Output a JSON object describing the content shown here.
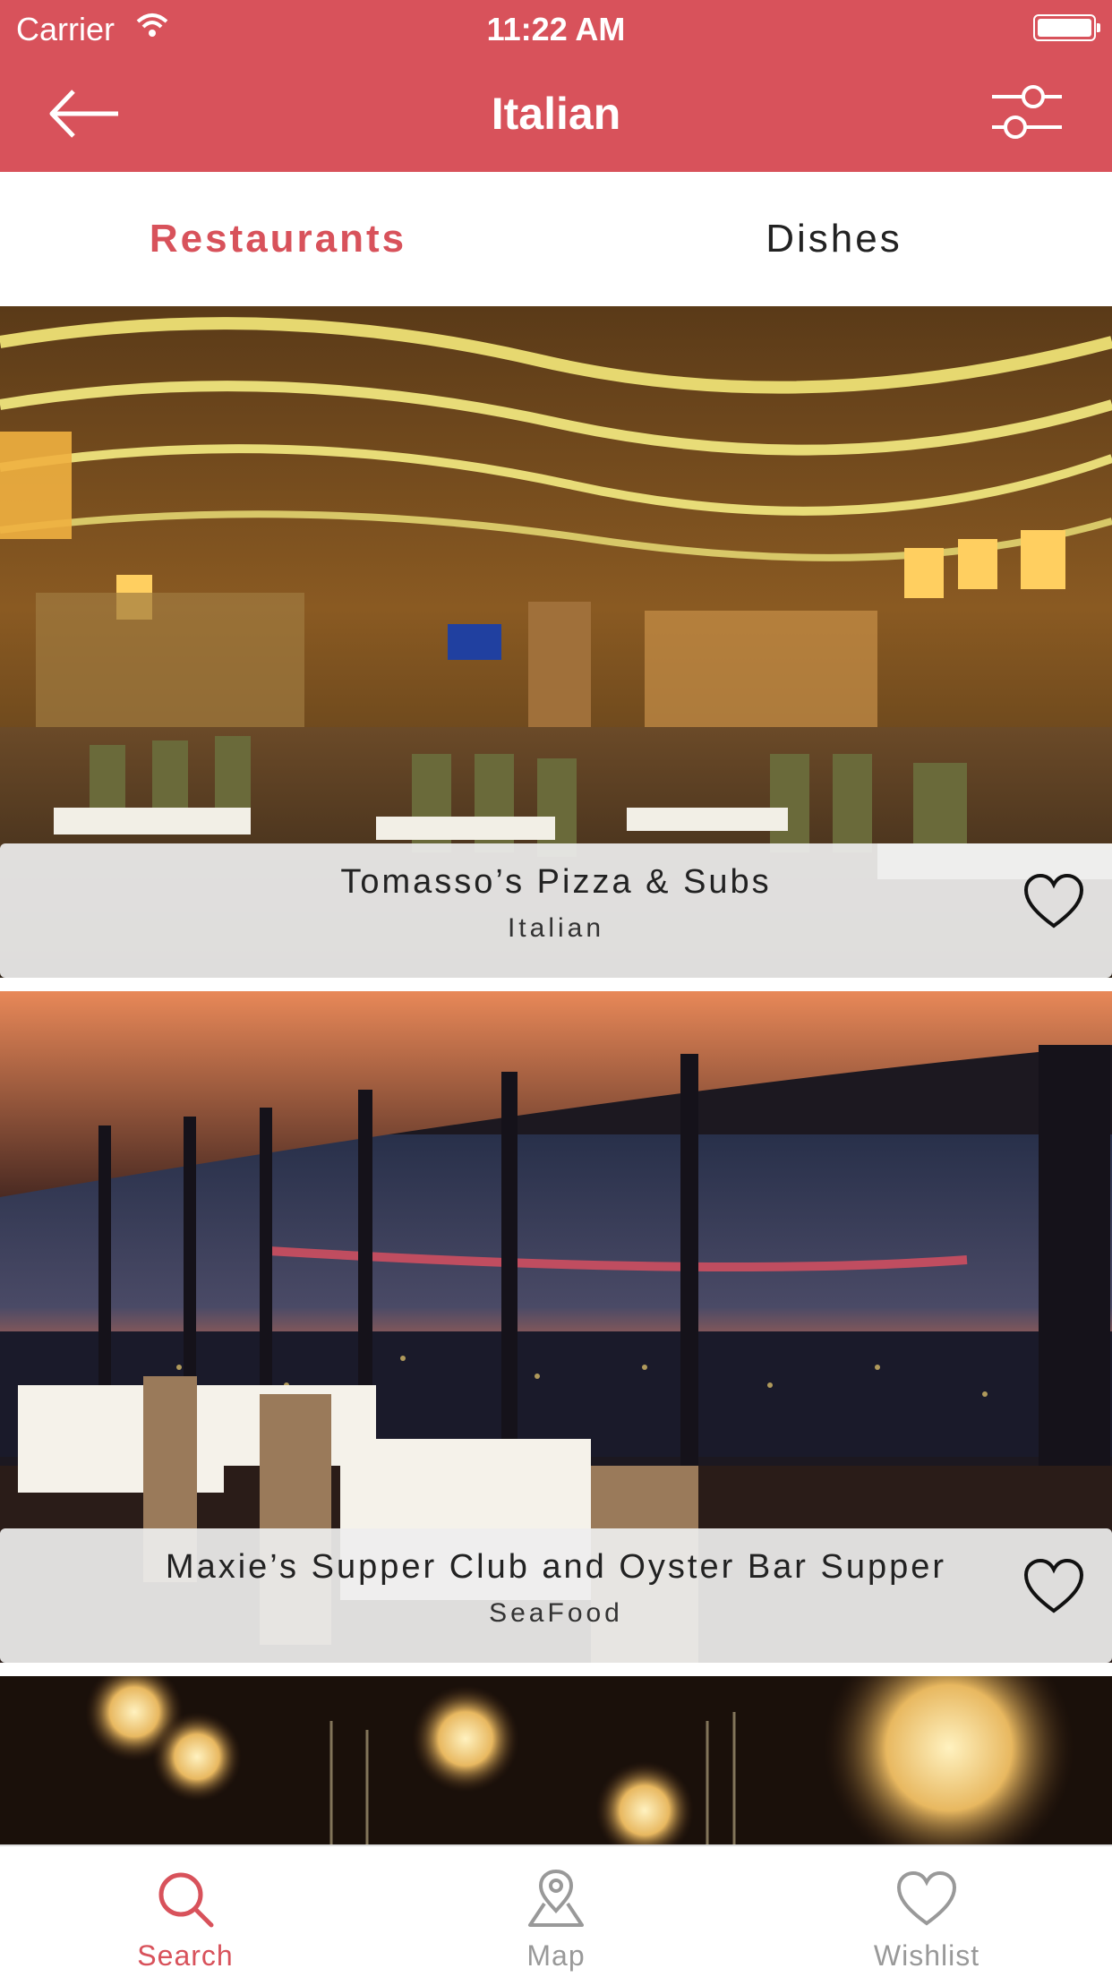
{
  "status_bar": {
    "carrier": "Carrier",
    "time": "11:22 AM"
  },
  "nav": {
    "title": "Italian"
  },
  "tabs": [
    {
      "label": "Restaurants",
      "active": true
    },
    {
      "label": "Dishes",
      "active": false
    }
  ],
  "restaurants": [
    {
      "name": "Tomasso’s Pizza & Subs",
      "category": "Italian",
      "image": "restaurant-interior-photo",
      "favorite_icon": "heart-outline-icon"
    },
    {
      "name": "Maxie’s Supper Club and Oyster Bar Supper",
      "category": "SeaFood",
      "image": "rooftop-restaurant-photo",
      "favorite_icon": "heart-outline-icon"
    },
    {
      "image": "pendant-lights-photo"
    }
  ],
  "tab_bar": [
    {
      "label": "Search",
      "icon": "search-icon",
      "active": true
    },
    {
      "label": "Map",
      "icon": "map-pin-icon",
      "active": false
    },
    {
      "label": "Wishlist",
      "icon": "heart-icon",
      "active": false
    }
  ],
  "colors": {
    "brand": "#d8525b",
    "tab_inactive": "#999999"
  }
}
